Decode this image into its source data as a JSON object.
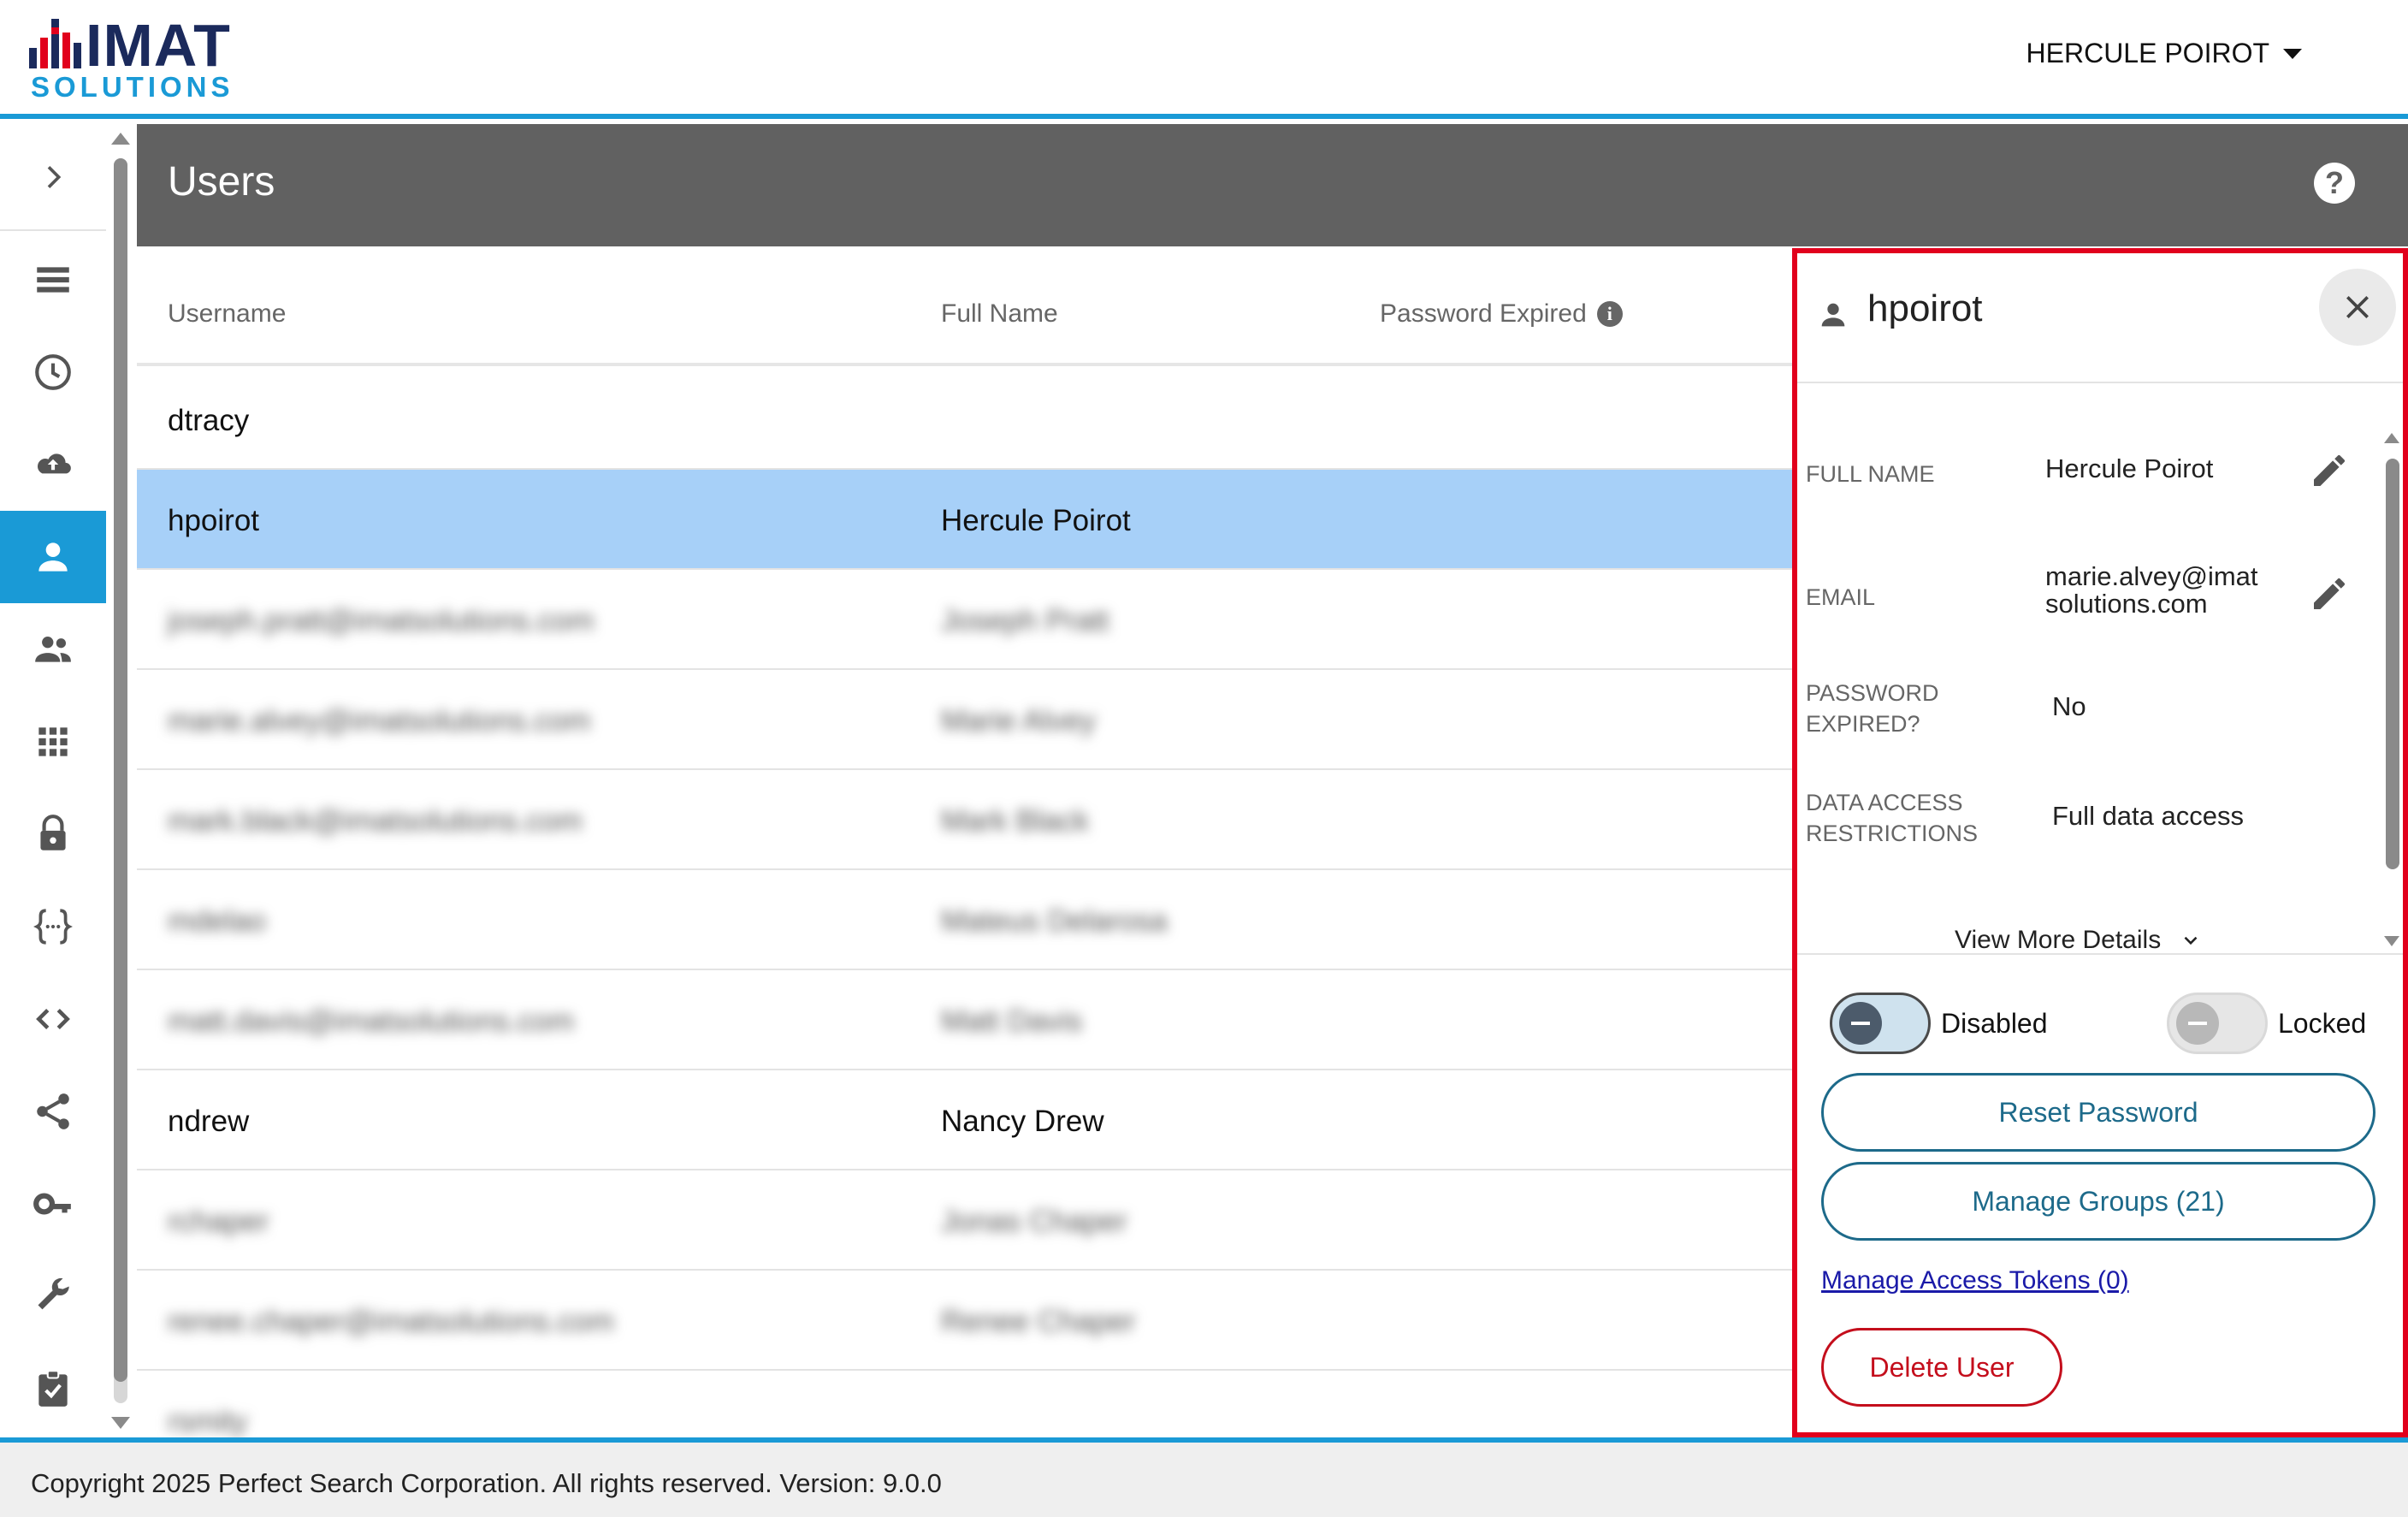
{
  "header": {
    "logo": {
      "top_text": "IMAT",
      "bottom_text": "SOLUTIONS"
    },
    "user_menu_label": "HERCULE POIROT"
  },
  "sidenav": {
    "items": [
      {
        "icon": "list-icon"
      },
      {
        "icon": "clock-icon"
      },
      {
        "icon": "cloud-upload-icon"
      },
      {
        "icon": "person-icon",
        "active": true
      },
      {
        "icon": "group-icon"
      },
      {
        "icon": "apps-grid-icon"
      },
      {
        "icon": "lock-icon"
      },
      {
        "icon": "curly-braces-icon"
      },
      {
        "icon": "code-icon"
      },
      {
        "icon": "share-icon"
      },
      {
        "icon": "key-icon"
      },
      {
        "icon": "wrench-icon"
      },
      {
        "icon": "clipboard-check-icon"
      }
    ],
    "colors": {
      "active_bg": "#1a9ad6"
    }
  },
  "page": {
    "title": "Users"
  },
  "table": {
    "columns": [
      "Username",
      "Full Name",
      "Password Expired"
    ],
    "rows": [
      {
        "username": "dtracy",
        "full_name": "",
        "blurred": false
      },
      {
        "username": "hpoirot",
        "full_name": "Hercule Poirot",
        "blurred": false,
        "selected": true
      },
      {
        "username": "joseph.pratt@imatsolutions.com",
        "full_name": "Joseph Pratt",
        "blurred": true
      },
      {
        "username": "marie.alvey@imatsolutions.com",
        "full_name": "Marie Alvey",
        "blurred": true
      },
      {
        "username": "mark.black@imatsolutions.com",
        "full_name": "Mark Black",
        "blurred": true
      },
      {
        "username": "mdelao",
        "full_name": "Mateus Delarosa",
        "blurred": true
      },
      {
        "username": "matt.davis@imatsolutions.com",
        "full_name": "Matt Davis",
        "blurred": true
      },
      {
        "username": "ndrew",
        "full_name": "Nancy Drew",
        "blurred": false
      },
      {
        "username": "rchaper",
        "full_name": "Jonas Chaper",
        "blurred": true
      },
      {
        "username": "renee.chaper@imatsolutions.com",
        "full_name": "Renee Chaper",
        "blurred": true
      },
      {
        "username": "rsmity",
        "full_name": "",
        "blurred": true
      }
    ]
  },
  "detail_panel": {
    "username": "hpoirot",
    "fields": [
      {
        "label": "FULL NAME",
        "value": "Hercule Poirot",
        "editable": true
      },
      {
        "label": "EMAIL",
        "value": "marie.alvey@imat solutions.com",
        "editable": true
      },
      {
        "label": "PASSWORD EXPIRED?",
        "value": "No",
        "editable": false
      },
      {
        "label": "DATA ACCESS RESTRICTIONS",
        "value": "Full data access",
        "editable": false
      }
    ],
    "view_more_label": "View More Details",
    "toggles": [
      {
        "label": "Disabled",
        "on": true
      },
      {
        "label": "Locked",
        "on": false
      }
    ],
    "reset_password_label": "Reset Password",
    "manage_groups_label": "Manage Groups (21)",
    "manage_tokens_label": "Manage Access Tokens (0)",
    "delete_user_label": "Delete User",
    "colors": {
      "highlight_border": "#e1001c",
      "primary": "#1d6a8a",
      "danger": "#c40e1c"
    }
  },
  "footer": {
    "text": "Copyright 2025 Perfect Search Corporation. All rights reserved. Version: 9.0.0"
  }
}
